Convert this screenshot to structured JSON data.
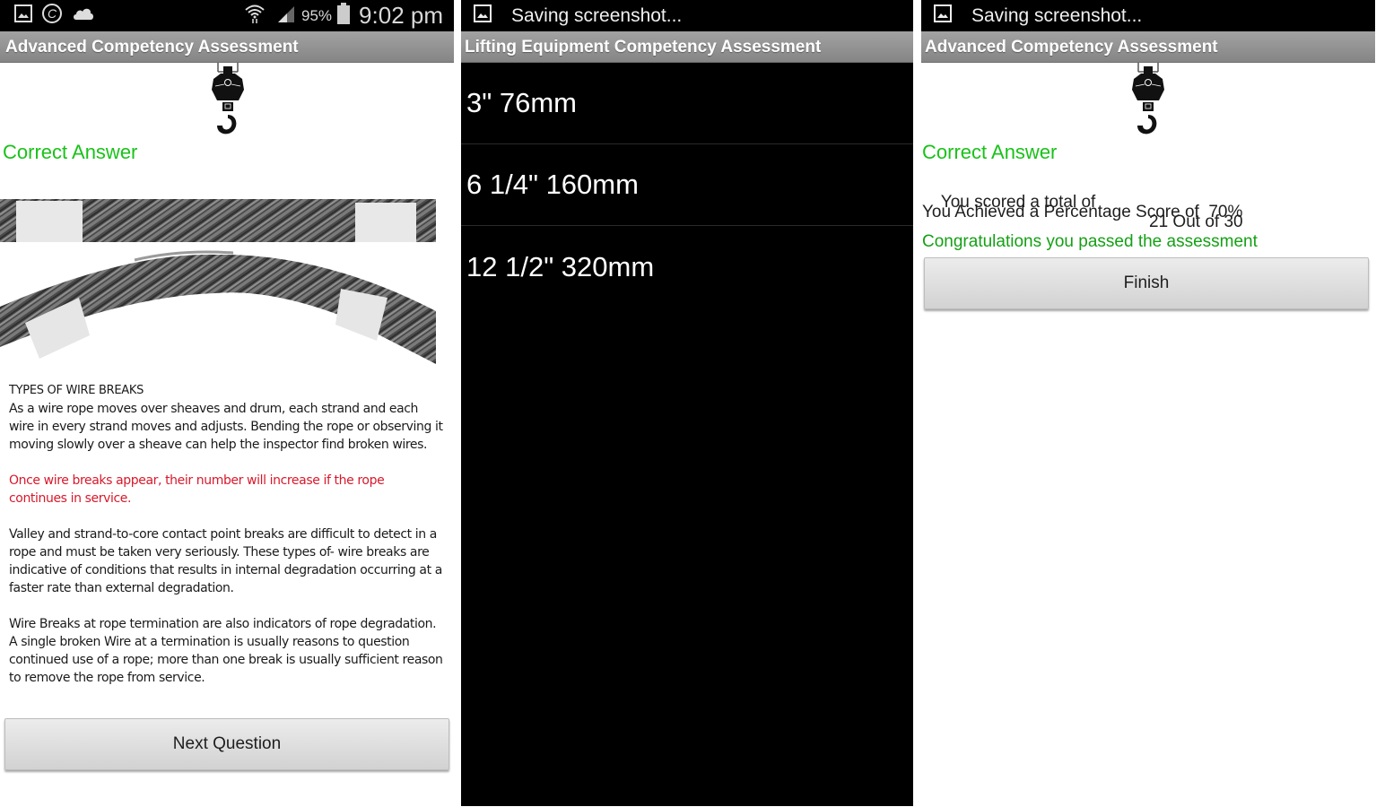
{
  "panel1": {
    "status_bar": {
      "left_icons": [
        "gallery-icon",
        "copyright-icon",
        "cloud-icon"
      ],
      "right_icons": [
        "wifi-icon",
        "signal-icon",
        "battery-icon"
      ],
      "battery_percent": "95%",
      "time": "9:02 pm"
    },
    "title": "Advanced Competency Assessment",
    "logo_icon": "crane-hook-icon",
    "result_label": "Correct Answer",
    "image_alt": "wire-rope-breaks-photo",
    "article": {
      "heading": "TYPES OF WIRE BREAKS",
      "paragraphs": [
        "As a wire rope moves over sheaves and drum, each strand and each wire in every strand moves and adjusts. Bending the rope or observing it moving slowly over a sheave can help the inspector find broken wires.",
        "Once wire breaks appear, their number will increase if the rope continues in service.",
        "Valley and strand-to-core contact point breaks are difficult to detect in a rope and must be taken very seriously. These types of- wire breaks are indicative of conditions that results in internal degradation occurring at a faster rate than external degradation.",
        "Wire Breaks at rope termination are also indicators of rope degradation. A single broken Wire at a termination is usually reasons to question continued use of a rope; more than one break is usually sufficient reason to remove the rope from service."
      ]
    },
    "next_button": "Next Question"
  },
  "panel2": {
    "status_bar": {
      "notification_icon": "gallery-icon",
      "notification_text": "Saving screenshot..."
    },
    "title": "Lifting Equipment Competency Assessment",
    "options": [
      "3\" 76mm",
      "6 1/4\" 160mm",
      "12 1/2\" 320mm"
    ]
  },
  "panel3": {
    "status_bar": {
      "notification_icon": "gallery-icon",
      "notification_text": "Saving screenshot..."
    },
    "title": "Advanced Competency Assessment",
    "logo_icon": "crane-hook-icon",
    "result_label": "Correct Answer",
    "score_label": "You scored a total of",
    "score_value": "21 Out of 30",
    "percentage_line": "You Achieved a Percentage Score of  70%",
    "pass_message": "Congratulations you passed the assessment",
    "finish_button": "Finish"
  },
  "colors": {
    "correct_green": "#19c219",
    "pass_green": "#15a015",
    "warning_red": "#d8182a",
    "titlebar_gray": "#959595"
  }
}
